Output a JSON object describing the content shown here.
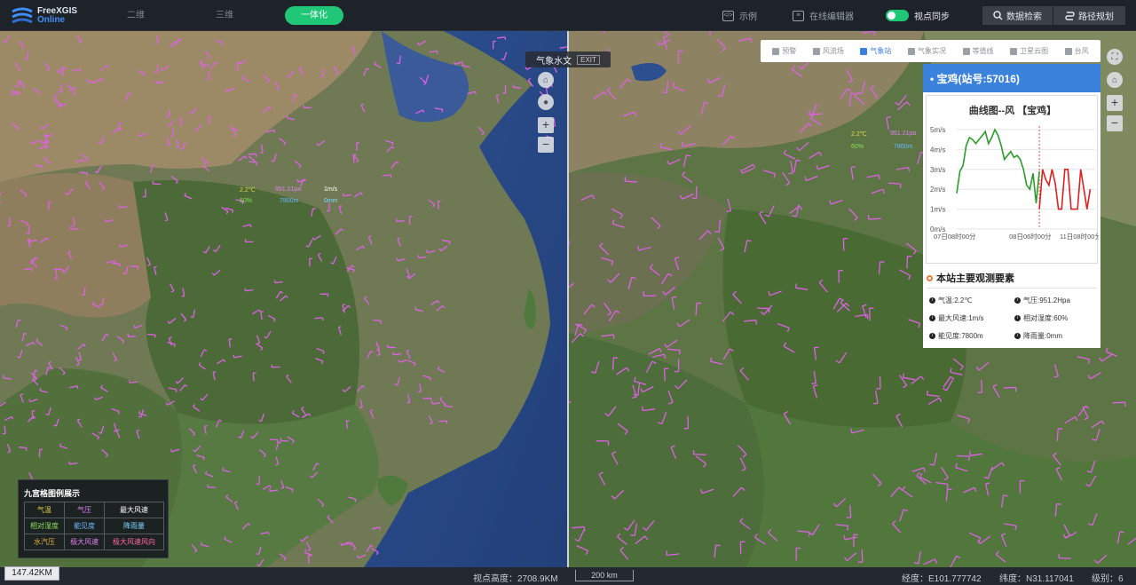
{
  "app": {
    "logo_line1": "FreeXGIS",
    "logo_line2": "Online"
  },
  "mode_tabs": [
    {
      "label": "二维",
      "active": false
    },
    {
      "label": "三维",
      "active": false
    },
    {
      "label": "一体化",
      "active": true
    }
  ],
  "top_links": {
    "example": "示例",
    "online_editor": "在线编辑器",
    "view_sync": "视点同步",
    "data_search": "数据检索",
    "route_plan": "路径规划"
  },
  "tip_bar": {
    "label": "气象水文",
    "exit": "EXIT"
  },
  "toolbar_items": [
    {
      "label": "预警",
      "active": false
    },
    {
      "label": "风流场",
      "active": false
    },
    {
      "label": "气象站",
      "active": true
    },
    {
      "label": "气象实况",
      "active": false
    },
    {
      "label": "等值线",
      "active": false
    },
    {
      "label": "卫星云图",
      "active": false
    },
    {
      "label": "台风",
      "active": false
    }
  ],
  "map_labels_left": {
    "temp": "2.2℃",
    "pressure": "951.21pa",
    "wind": "1m/s",
    "humidity": "60%",
    "visibility": "7800m",
    "rain": "0mm"
  },
  "map_labels_right": {
    "temp": "2.2℃",
    "pressure": "951.21pa",
    "humidity": "60%",
    "visibility": "7800m"
  },
  "station_panel": {
    "header": "• 宝鸡(站号:57016)",
    "chart_title": "曲线图--风 【宝鸡】",
    "observations_title": "本站主要观测要素",
    "observations": [
      {
        "label": "气温:2.2℃"
      },
      {
        "label": "气压:951.2Hpa"
      },
      {
        "label": "最大风速:1m/s"
      },
      {
        "label": "相对湿度:60%"
      },
      {
        "label": "能见度:7800m"
      },
      {
        "label": "降雨量:0mm"
      }
    ]
  },
  "chart_data": {
    "type": "line",
    "title": "曲线图--风 【宝鸡】",
    "y_ticks": [
      "0m/s",
      "1m/s",
      "2m/s",
      "3m/s",
      "4m/s",
      "5m/s"
    ],
    "ylim": [
      0,
      5
    ],
    "x_ticks": [
      "07日08时00分",
      "08日06时00分",
      "11日08时00分"
    ],
    "series": [
      {
        "color": "#2a9d2a",
        "values": [
          1.8,
          2.9,
          3.2,
          4.2,
          4.6,
          4.5,
          4.3,
          4.5,
          4.7,
          4.9,
          4.3,
          4.6,
          5.0,
          4.7,
          4.2,
          3.5,
          3.7,
          3.9,
          3.6,
          3.7,
          3.5,
          3.0,
          2.2,
          2.0,
          2.8,
          1.3,
          2.9
        ]
      },
      {
        "color": "#e02020",
        "values": [
          1.0,
          3.0,
          2.5,
          2.2,
          3.0,
          2.3,
          1.0,
          1.0,
          3.0,
          3.0,
          1.0,
          1.0,
          1.0,
          3.0,
          2.0,
          1.0,
          2.0
        ]
      }
    ],
    "marker": "08日06时00分"
  },
  "legend": {
    "title": "九宫格图例展示",
    "cells": [
      {
        "label": "气温",
        "color": "#e8d44a"
      },
      {
        "label": "气压",
        "color": "#e080f0"
      },
      {
        "label": "最大风速",
        "color": "#ffffff"
      },
      {
        "label": "相对湿度",
        "color": "#8be05a"
      },
      {
        "label": "能见度",
        "color": "#6ab8ff"
      },
      {
        "label": "降雨量",
        "color": "#7fd6ff"
      },
      {
        "label": "水汽压",
        "color": "#e8b040"
      },
      {
        "label": "极大风速",
        "color": "#e080f0"
      },
      {
        "label": "极大风速风向",
        "color": "#ff6a9a"
      }
    ]
  },
  "status": {
    "scale_left": "147.42KM",
    "view_height": "视点高度：2708.9KM",
    "scale_right": "200 km",
    "longitude": "经度：E101.777742",
    "latitude": "纬度：N31.117041",
    "level": "级别：6"
  }
}
